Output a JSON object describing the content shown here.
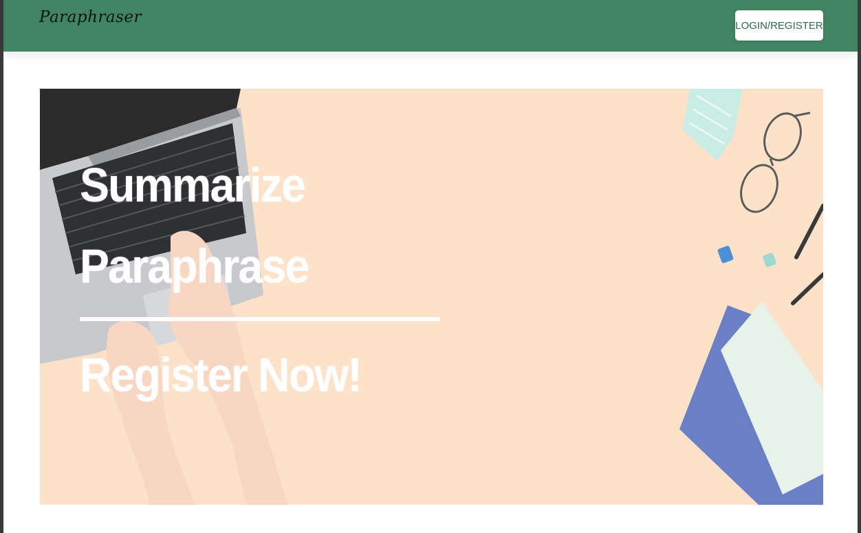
{
  "navbar": {
    "brand": "Paraphraser",
    "login_label": "LOGIN/REGISTER",
    "background": "#418462"
  },
  "hero": {
    "line1": "Summarize",
    "line2": "Paraphrase",
    "cta": "Register Now!",
    "background": "#fde2ca",
    "illustration": "desk-with-laptop-glasses-notebooks"
  }
}
